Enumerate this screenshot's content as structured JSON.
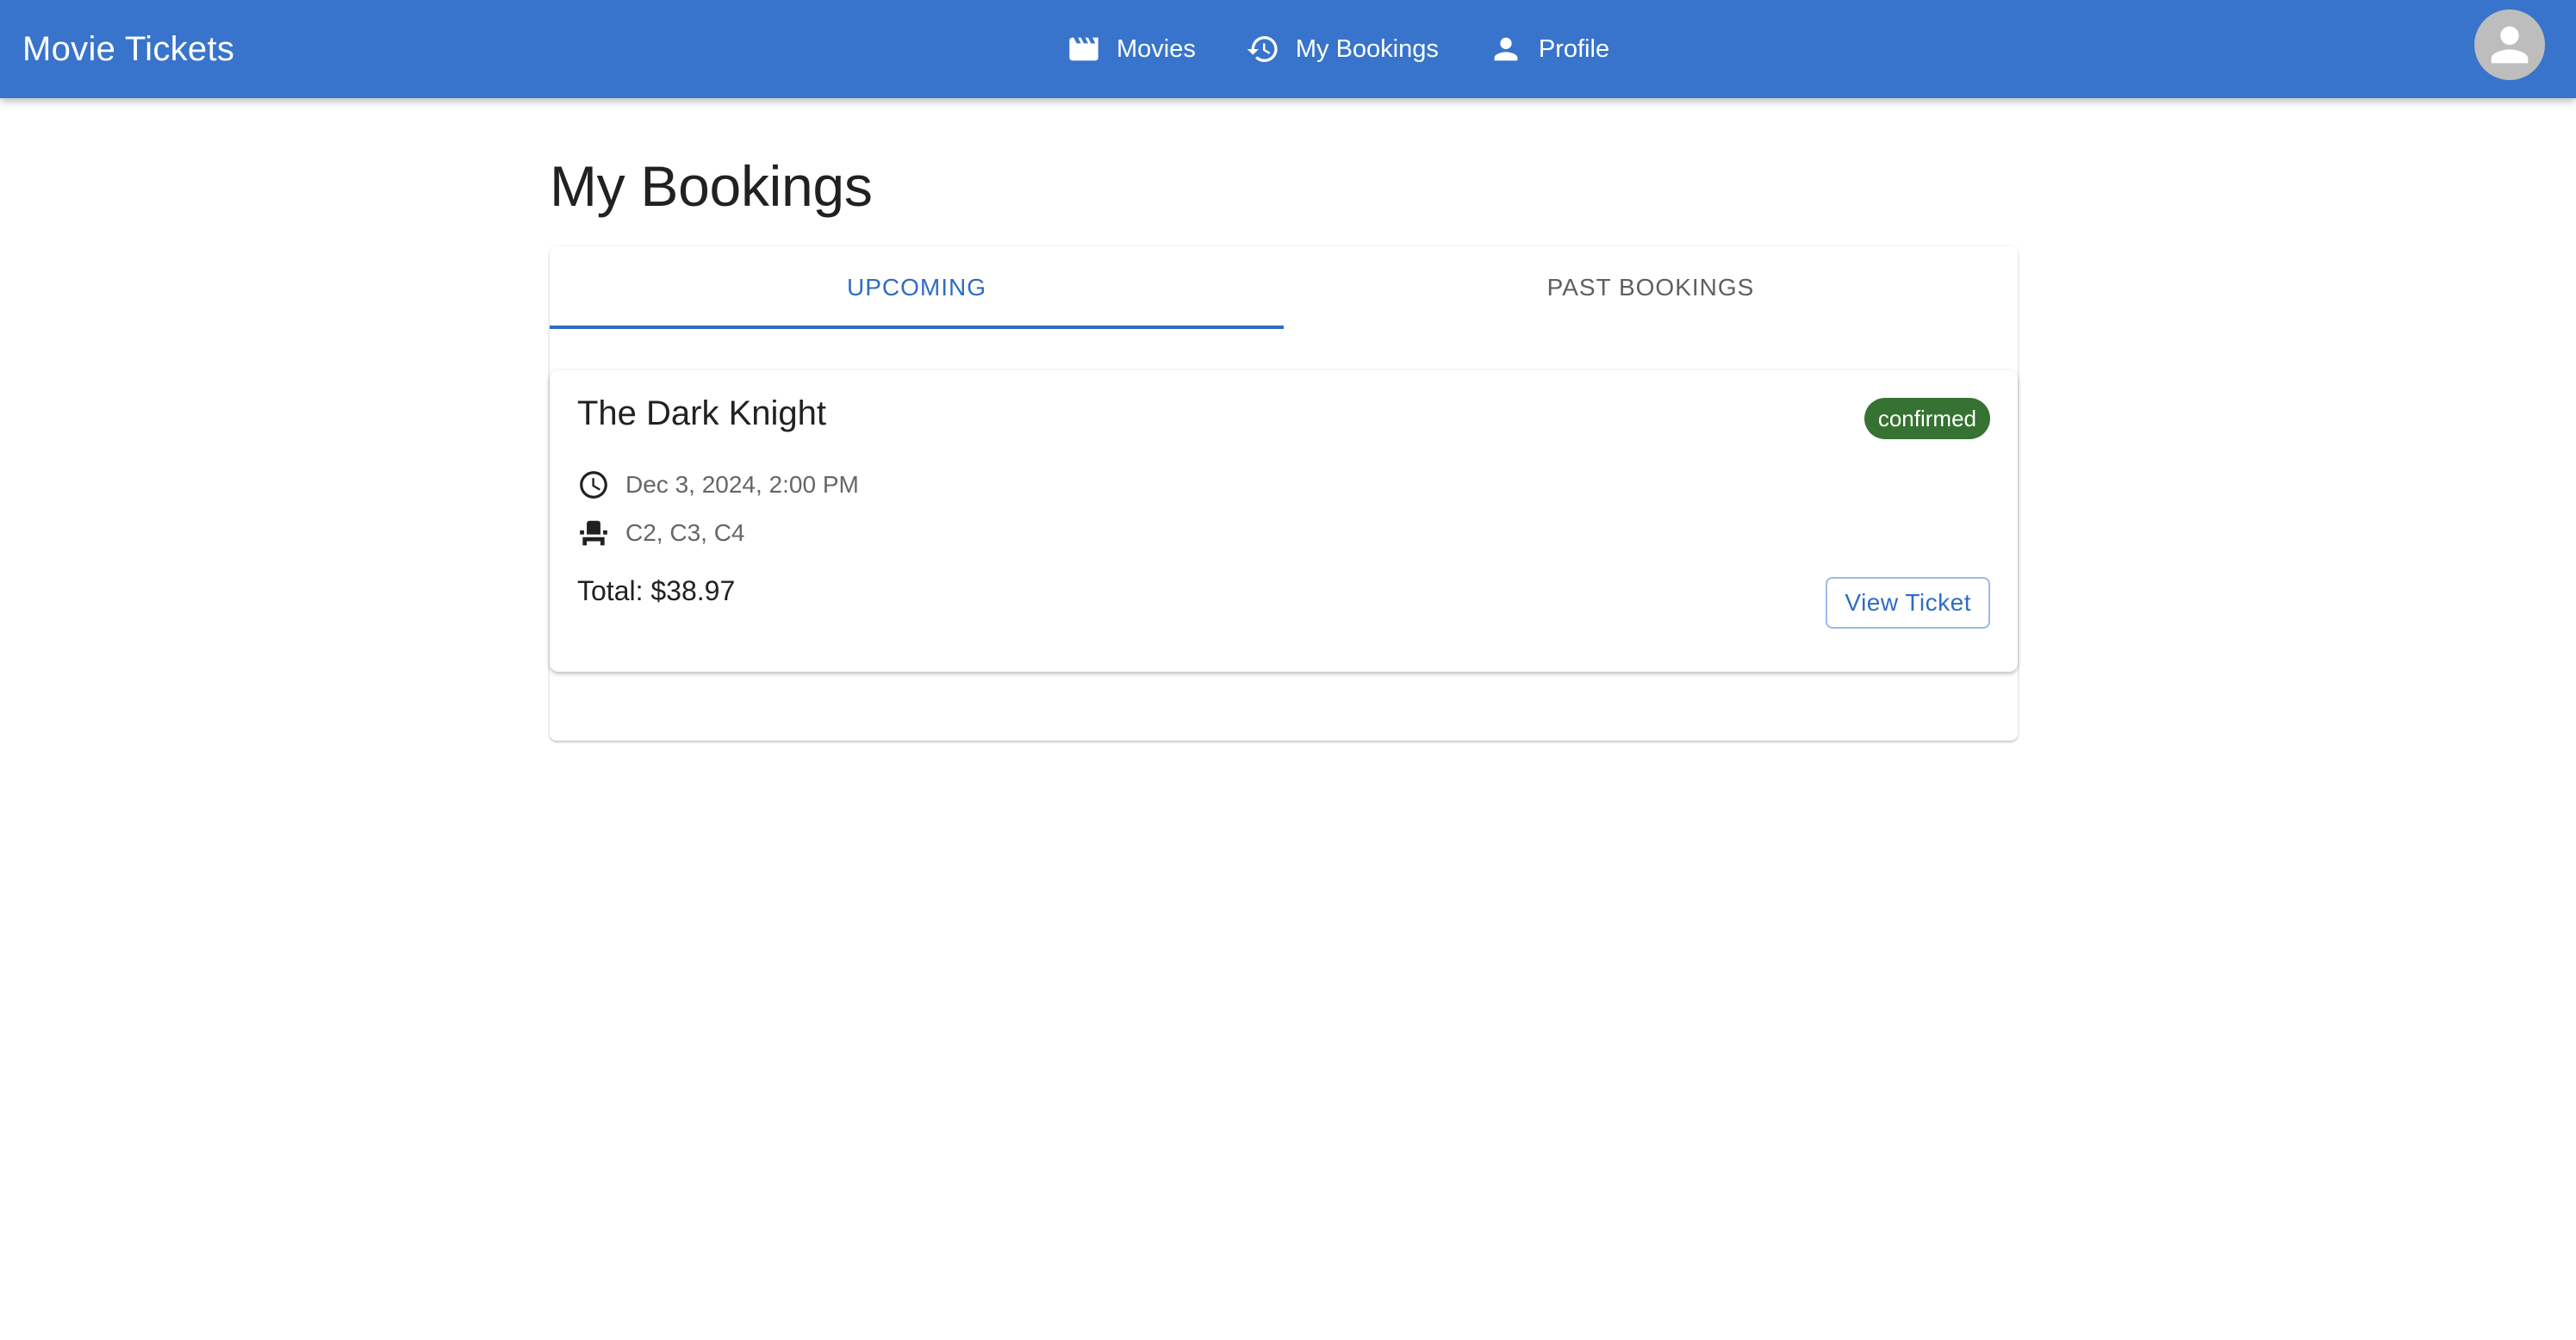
{
  "app": {
    "title": "Movie Tickets",
    "brand_color": "#3874cb"
  },
  "nav": {
    "items": [
      {
        "label": "Movies",
        "icon": "clapperboard-icon"
      },
      {
        "label": "My Bookings",
        "icon": "history-icon"
      },
      {
        "label": "Profile",
        "icon": "person-icon"
      }
    ]
  },
  "user": {
    "avatar_icon": "account-circle-icon"
  },
  "page": {
    "title": "My Bookings"
  },
  "tabs": [
    {
      "label": "Upcoming",
      "active": true
    },
    {
      "label": "Past Bookings",
      "active": false
    }
  ],
  "bookings": [
    {
      "movie": "The Dark Knight",
      "status": "confirmed",
      "status_color": "#367232",
      "datetime": "Dec 3, 2024, 2:00 PM",
      "datetime_icon": "clock-icon",
      "seats": "C2, C3, C4",
      "seats_icon": "seat-icon",
      "total": "Total: $38.97",
      "action_label": "View Ticket"
    }
  ]
}
